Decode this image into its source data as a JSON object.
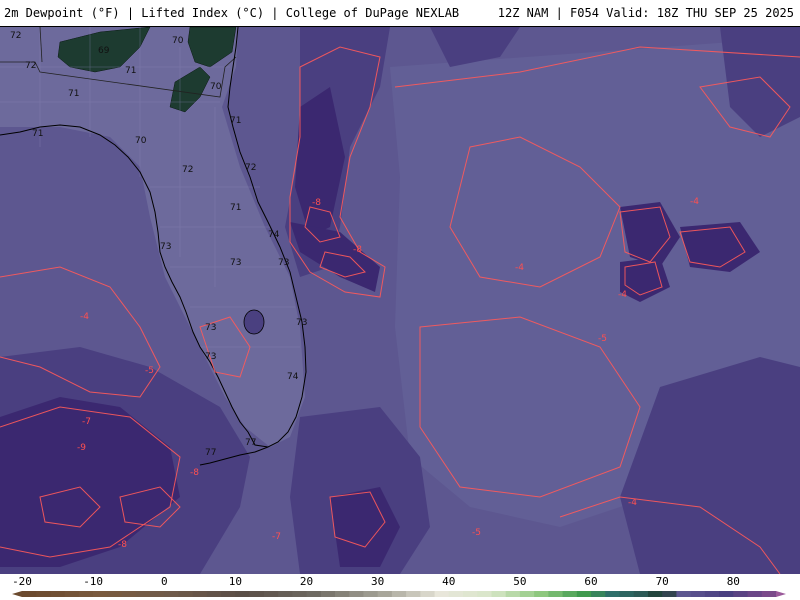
{
  "header": {
    "title_left": "2m Dewpoint (°F) | Lifted Index (°C) | College of DuPage NEXLAB",
    "title_right": "12Z NAM | F054 Valid: 18Z THU SEP 25 2025"
  },
  "colors": {
    "background_purple": "#5d5790",
    "deep_purple": "#3f2d75",
    "mid_purple": "#4e4682",
    "light_purple": "#6a679a",
    "land_green": "#1d3b30",
    "contour_red": "#ff5a5a",
    "coast_black": "#000000"
  },
  "dewpoint_labels": [
    "72",
    "72",
    "69",
    "70",
    "72",
    "71",
    "71",
    "71",
    "70",
    "71",
    "70",
    "72",
    "72",
    "71",
    "74",
    "73",
    "73",
    "73",
    "73",
    "73",
    "74",
    "77",
    "77"
  ],
  "lifted_index_labels": [
    "-8",
    "-8",
    "-4",
    "-4",
    "-4",
    "-5",
    "-5",
    "-4",
    "-7",
    "-9",
    "-8",
    "-8",
    "-7",
    "-5",
    "-4"
  ],
  "colorbar": {
    "ticks": [
      "-20",
      "-10",
      "0",
      "10",
      "20",
      "30",
      "40",
      "50",
      "60",
      "70",
      "80"
    ],
    "min": -20,
    "max": 86
  }
}
